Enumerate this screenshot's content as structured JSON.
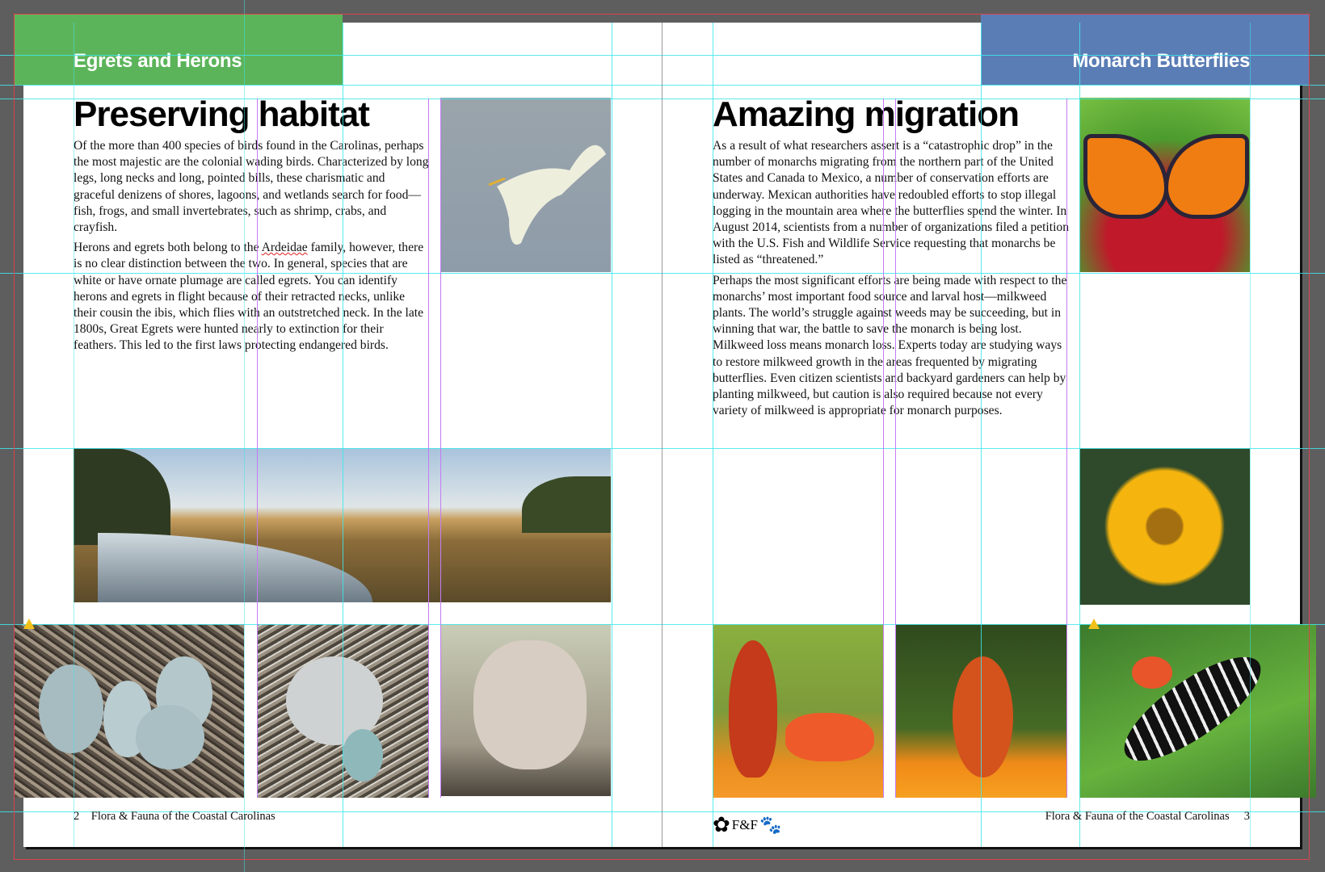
{
  "left_page": {
    "section_label": "Egrets and Herons",
    "section_color": "#5cb45a",
    "title": "Preserving habitat",
    "paragraphs": [
      "Of the more than 400 species of birds found in the Carolinas, perhaps the most majestic are the colonial wading birds. Characterized by long legs, long necks and long, pointed bills, these charismatic and graceful denizens of shores, lagoons, and wetlands search for food—fish, frogs, and small invertebrates, such as shrimp, crabs, and crayfish."
    ],
    "para2_before": "Herons and egrets both belong to the ",
    "para2_flagged_word": "Ardeidae",
    "para2_after": " family, however, there is no clear distinction between the two. In general, species that are white or have ornate plumage are called egrets. You can identify herons and egrets in flight because of their retracted necks, unlike their cousin the ibis, which flies with an outstretched neck. In the late 1800s, Great Egrets were hunted nearly to extinction for their feathers. This led to the first laws protecting endangered birds.",
    "page_number": "2",
    "footer_text": "Flora & Fauna of the Coastal Carolinas",
    "images": [
      "egret-in-flight",
      "marsh-landscape",
      "eggs-in-nest",
      "chicks-with-egg",
      "egret-chicks"
    ]
  },
  "right_page": {
    "section_label": "Monarch Butterflies",
    "section_color": "#5b7db5",
    "title": "Amazing migration",
    "paragraphs": [
      "As a result of what researchers assert is a “catastrophic drop” in the number of monarchs migrating from the northern part of the United States and Canada to Mexico, a number of conservation efforts are underway. Mexican authorities have redoubled efforts to stop illegal logging in the mountain area where the butterflies spend the winter. In August 2014, scientists from a number of organizations filed a petition with the U.S. Fish and Wildlife Service requesting that monarchs be listed as “threatened.”",
      "Perhaps the most significant efforts are being made with respect to the monarchs’ most important food source and larval host—milkweed plants. The world’s struggle against weeds may be succeeding, but in winning that war, the battle to save the monarch is being lost. Milkweed loss means monarch loss. Experts today are studying ways to restore milkweed growth in the areas frequented by migrating butterflies. Even citizen scientists and backyard gardeners can help by planting milkweed, but caution is also required because not every variety of milkweed is appropriate for monarch purposes."
    ],
    "page_number": "3",
    "footer_text": "Flora & Fauna of the Coastal Carolinas",
    "logo_text": "F&F",
    "images": [
      "monarch-butterfly",
      "bee-on-yellow-flower",
      "gulf-fritillary-1",
      "gulf-fritillary-2",
      "zebra-longwing"
    ]
  },
  "colors": {
    "pasteboard": "#5e5e5e",
    "guide": "#3fe6ec",
    "margin_guide": "#c37cf5",
    "bleed": "#d9434f",
    "warning": "#f2c21b"
  },
  "warnings": [
    "image-warning",
    "image-warning"
  ]
}
